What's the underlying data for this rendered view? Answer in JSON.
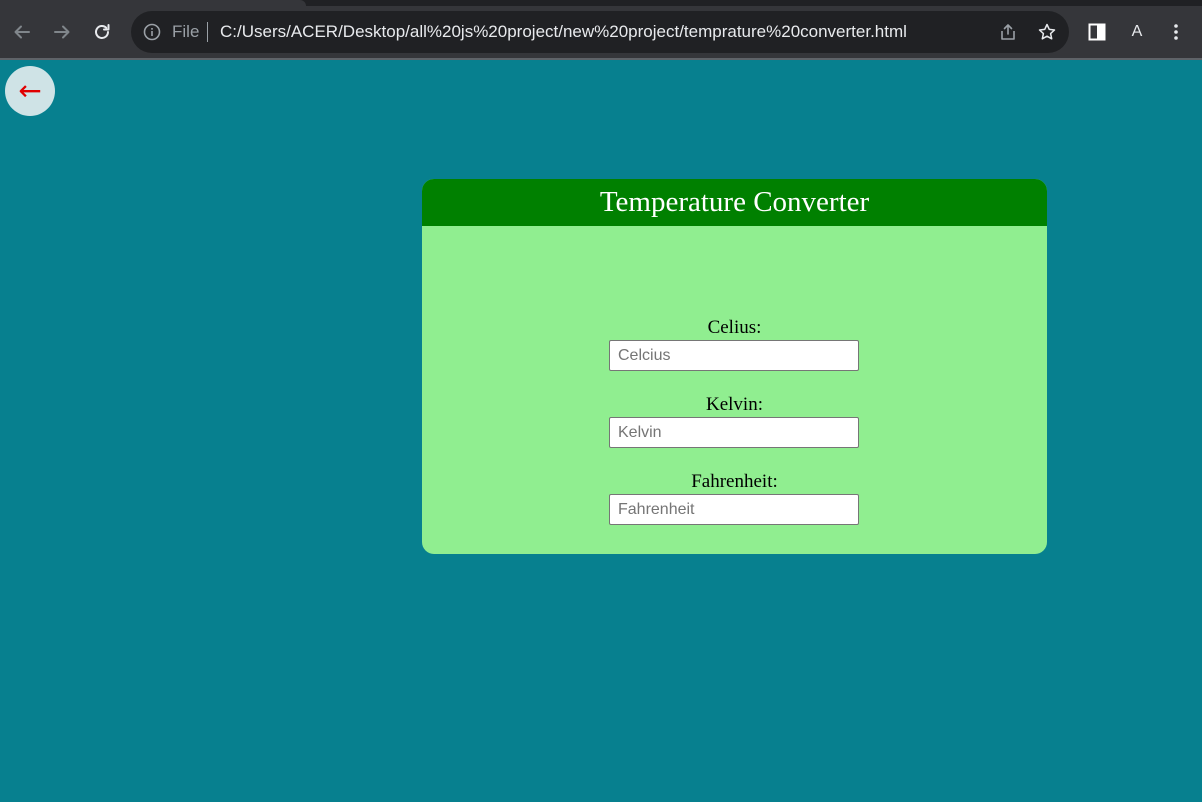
{
  "browser": {
    "scheme_label": "File",
    "url": "C:/Users/ACER/Desktop/all%20js%20project/new%20project/temprature%20converter.html",
    "profile_initial": "A",
    "icons": [
      "back-arrow-icon",
      "forward-arrow-icon",
      "reload-icon",
      "info-icon",
      "share-icon",
      "star-icon",
      "side-panel-icon",
      "kebab-menu-icon"
    ]
  },
  "page": {
    "back_link": "←",
    "card": {
      "title": "Temperature Converter",
      "fields": [
        {
          "label": "Celius:",
          "placeholder": "Celcius",
          "value": ""
        },
        {
          "label": "Kelvin:",
          "placeholder": "Kelvin",
          "value": ""
        },
        {
          "label": "Fahrenheit:",
          "placeholder": "Fahrenheit",
          "value": ""
        }
      ]
    }
  },
  "colors": {
    "page_background": "#07808f",
    "card_background": "#90ee90",
    "card_header": "#008000",
    "back_arrow": "#e00000"
  }
}
